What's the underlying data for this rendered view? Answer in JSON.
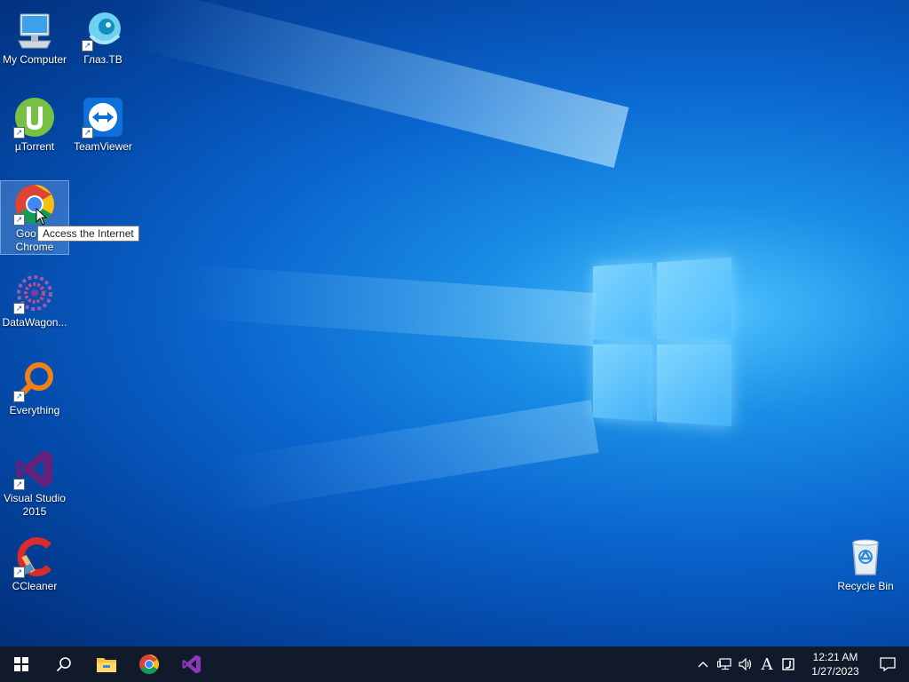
{
  "desktop": {
    "icons": [
      {
        "label": "My Computer",
        "icon": "computer-icon"
      },
      {
        "label": "Глаз.ТВ",
        "icon": "glaz-tv-icon"
      },
      {
        "label": "µTorrent",
        "icon": "utorrent-icon"
      },
      {
        "label": "TeamViewer",
        "icon": "teamviewer-icon"
      },
      {
        "label": "Google Chrome",
        "label_line1": "Goo",
        "label_line2": "Chrome",
        "icon": "chrome-icon"
      },
      {
        "label": "DataWagon...",
        "icon": "datawagon-icon"
      },
      {
        "label": "Everything",
        "icon": "everything-icon"
      },
      {
        "label": "Visual Studio 2015",
        "label_line1": "Visual Studio",
        "label_line2": "2015",
        "icon": "visual-studio-icon"
      },
      {
        "label": "CCleaner",
        "icon": "ccleaner-icon"
      },
      {
        "label": "Recycle Bin",
        "icon": "recycle-bin-icon"
      }
    ],
    "tooltip": "Access the Internet"
  },
  "taskbar": {
    "pinned": [
      "start-icon",
      "search-icon",
      "file-explorer-icon",
      "chrome-icon",
      "visual-studio-icon"
    ],
    "tray": {
      "input_indicator": "A",
      "time": "12:21 AM",
      "date": "1/27/2023"
    }
  },
  "colors": {
    "taskbar_bg": "#101a2a",
    "desktop_blue": "#0a66cf",
    "chrome_red": "#db4437",
    "chrome_yellow": "#f4c20d",
    "chrome_green": "#0f9d58",
    "chrome_blue": "#4285f4",
    "vs_purple": "#68217a"
  }
}
